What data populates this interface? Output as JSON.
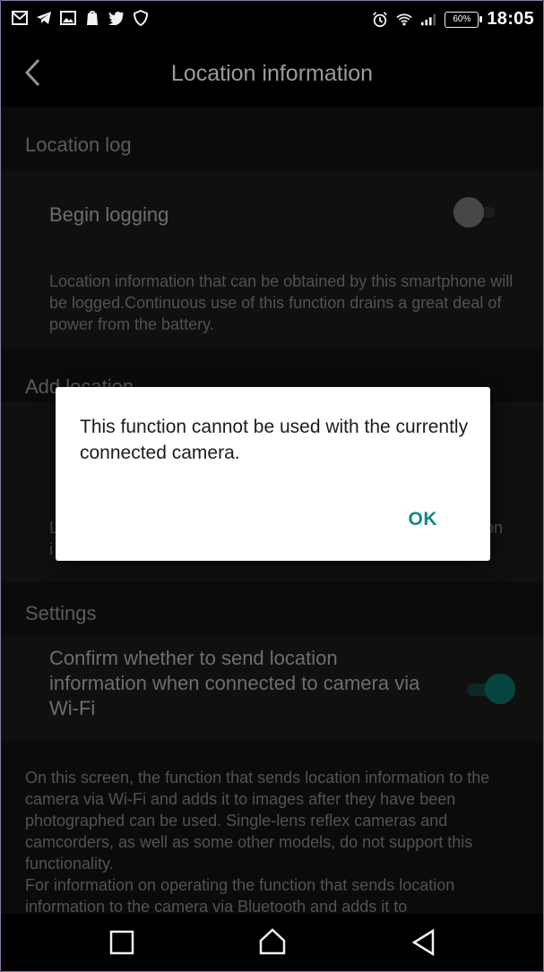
{
  "status_bar": {
    "left_icons": [
      "gmail-icon",
      "telegram-icon",
      "gallery-icon",
      "app-icon",
      "twitter-icon",
      "shield-icon"
    ],
    "battery": "60%",
    "time": "18:05"
  },
  "app_bar": {
    "title": "Location information"
  },
  "sections": {
    "location_log": {
      "header": "Location log",
      "begin_logging_label": "Begin logging",
      "description": "Location information that can be obtained by this smartphone will be logged.Continuous use of this function drains a great deal of power from the battery.",
      "toggle_on": false
    },
    "add_location": {
      "header": "Add location",
      "partial_left": "L",
      "partial_left2": "i",
      "partial_right": "on"
    },
    "settings": {
      "header": "Settings",
      "confirm_label": "Confirm whether to send location information when connected to camera via Wi-Fi",
      "toggle_on": true
    }
  },
  "footer_text": "On this screen, the function that sends location information to the camera via Wi-Fi and adds it to images after they have been photographed can be used. Single-lens reflex cameras and camcorders, as well as some other models, do not support this functionality.\nFor information on operating the function that sends location information to the camera via Bluetooth and adds it to",
  "dialog": {
    "message": "This function cannot be used with the currently connected camera.",
    "ok_label": "OK"
  },
  "colors": {
    "accent": "#138a80",
    "toggle_on": "#0e6b63"
  }
}
